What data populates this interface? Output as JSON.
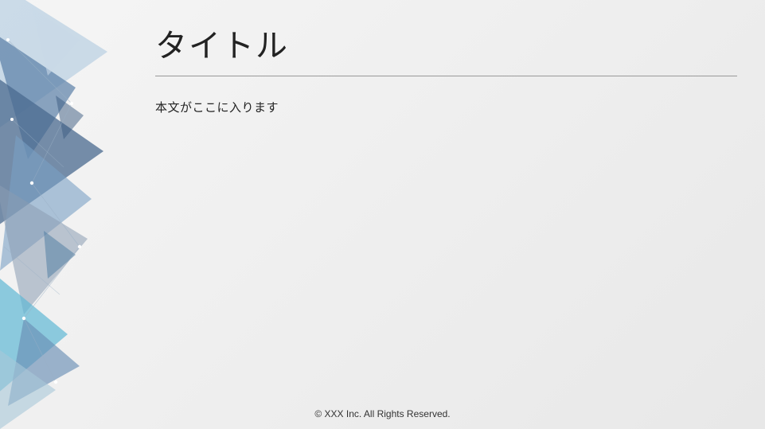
{
  "slide": {
    "title": "タイトル",
    "body": "本文がここに入ります",
    "footer": "© XXX Inc. All Rights Reserved."
  }
}
